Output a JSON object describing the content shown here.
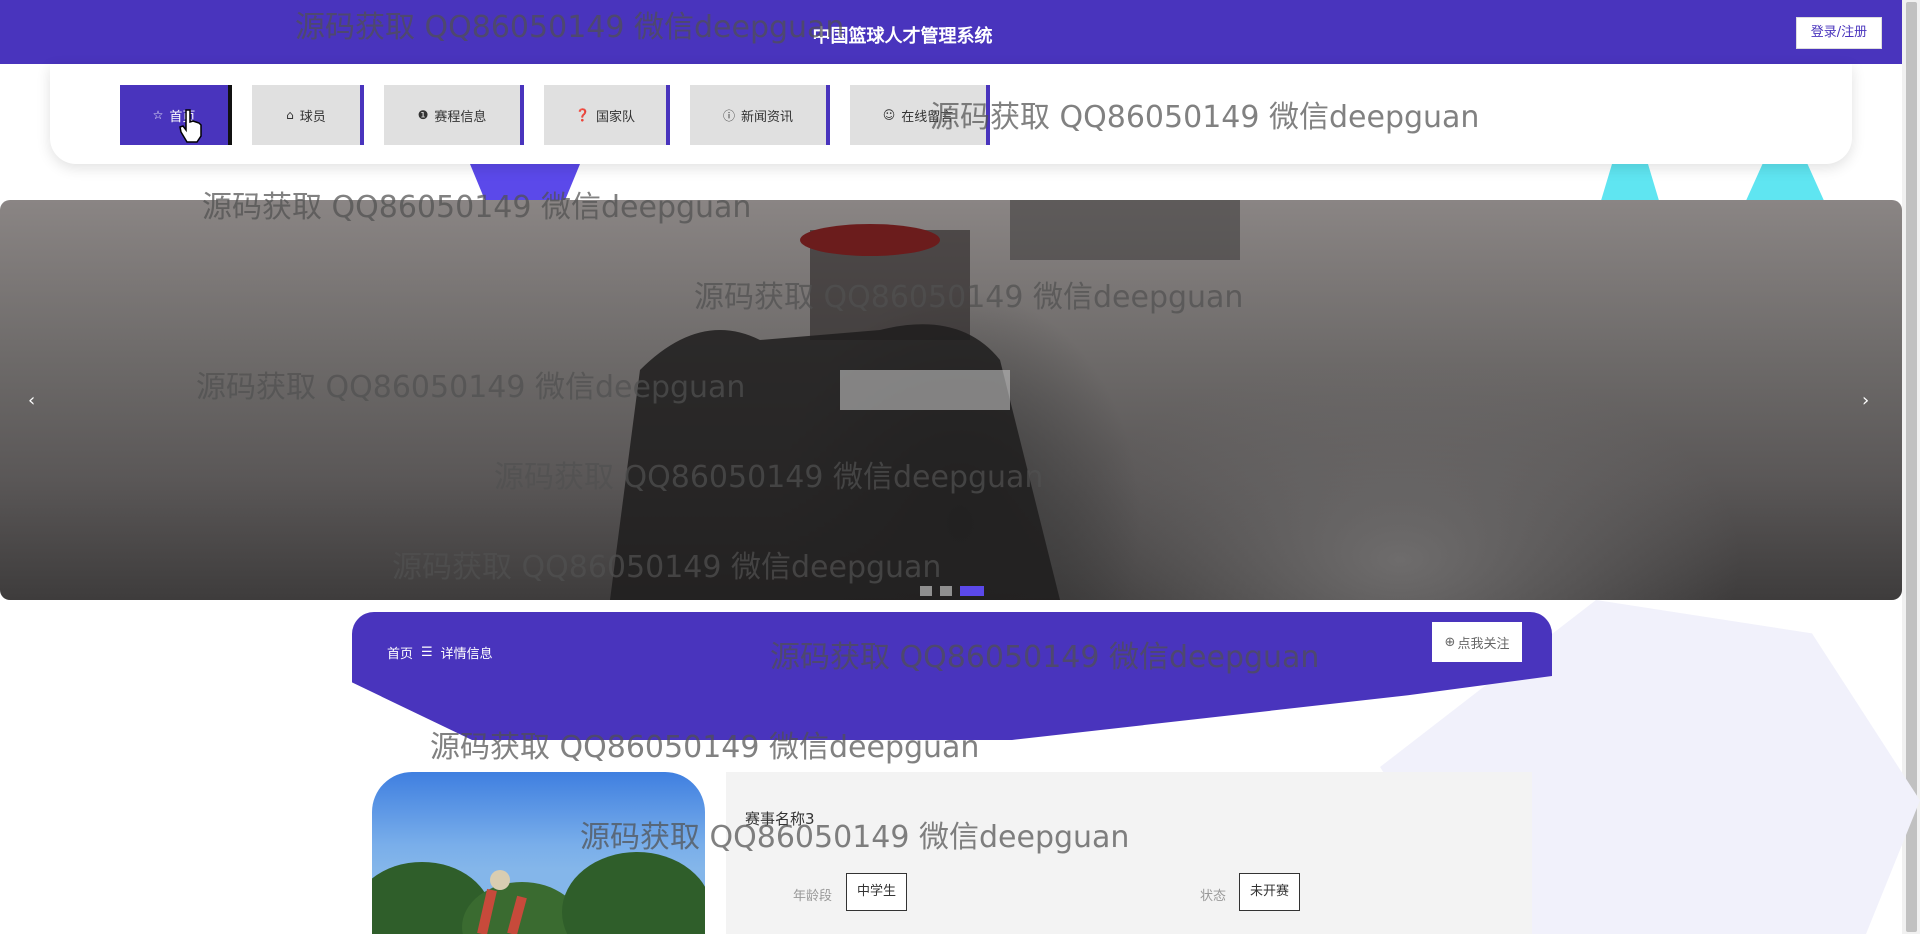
{
  "header": {
    "title": "中国篮球人才管理系统",
    "login_label": "登录/注册"
  },
  "nav": [
    {
      "label": "首页",
      "icon": "☆",
      "active": true
    },
    {
      "label": "球员",
      "icon": "⌂",
      "active": false
    },
    {
      "label": "赛程信息",
      "icon": "❶",
      "active": false
    },
    {
      "label": "国家队",
      "icon": "❓",
      "active": false
    },
    {
      "label": "新闻资讯",
      "icon": "ⓘ",
      "active": false
    },
    {
      "label": "在线留言",
      "icon": "☺",
      "active": false
    }
  ],
  "banner": {
    "prev": "‹",
    "next": "›",
    "slide_count": 3,
    "active_slide": 3
  },
  "breadcrumb": {
    "home": "首页",
    "separator": "☰",
    "current": "详情信息"
  },
  "follow": {
    "icon": "⊕",
    "label": "点我关注"
  },
  "detail": {
    "event_name": "赛事名称3",
    "age_group_label": "年龄段",
    "age_group_value": "中学生",
    "status_label": "状态",
    "status_value": "未开赛"
  },
  "watermark_text": "源码获取 QQ86050149 微信deepguan",
  "colors": {
    "primary": "#4934bd",
    "accent": "#5b49ea",
    "cyan": "#5fe5f1"
  }
}
